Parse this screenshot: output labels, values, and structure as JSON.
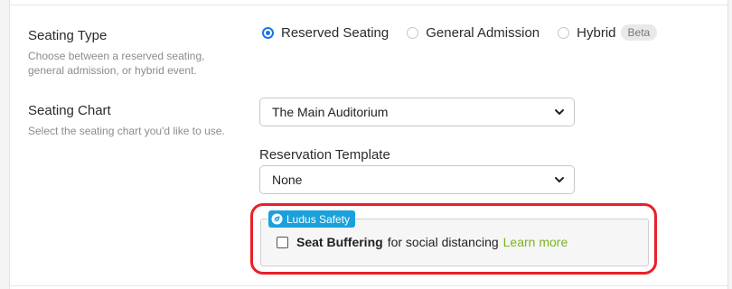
{
  "seating_type": {
    "title": "Seating Type",
    "help": "Choose between a reserved seating, general admission, or hybrid event.",
    "options": [
      {
        "label": "Reserved Seating",
        "checked": true
      },
      {
        "label": "General Admission",
        "checked": false
      },
      {
        "label": "Hybrid",
        "checked": false
      }
    ],
    "hybrid_badge": "Beta"
  },
  "seating_chart": {
    "title": "Seating Chart",
    "help": "Select the seating chart you'd like to use.",
    "selected": "The Main Auditorium"
  },
  "reservation_template": {
    "label": "Reservation Template",
    "selected": "None"
  },
  "ludus_safety": {
    "tag": "Ludus Safety",
    "checkbox_bold": "Seat Buffering",
    "checkbox_text": "for social distancing",
    "learn_more": "Learn more",
    "checked": false
  },
  "colors": {
    "accent": "#1a73e8",
    "safety_tag": "#1aa1db",
    "link": "#7ab51d",
    "highlight_ring": "#e8202a"
  }
}
